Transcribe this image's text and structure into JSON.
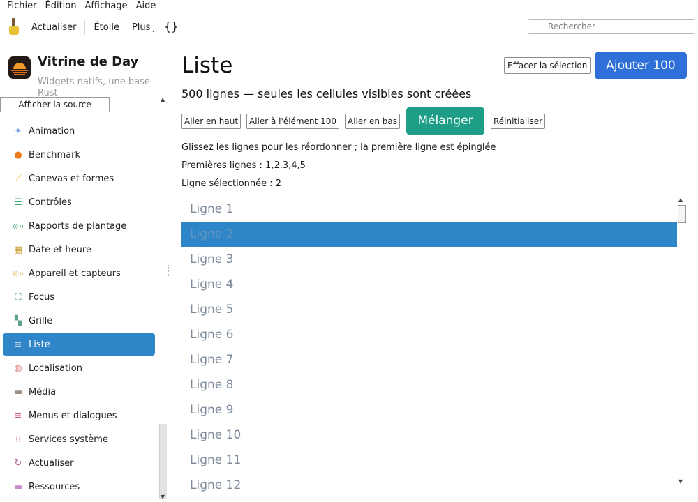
{
  "menubar": {
    "items": [
      "Fichier",
      "Édition",
      "Affichage",
      "Aide"
    ]
  },
  "toolbar": {
    "refresh_label": "Actualiser",
    "star_label": "Étoile",
    "more_label": "Plus",
    "more_chevron": "⌄",
    "braces": "{}",
    "search_placeholder": "Rechercher"
  },
  "app": {
    "title": "Vitrine de Day",
    "subtitle": "Widgets natifs, une base Rust"
  },
  "sidebar": {
    "show_source_label": "Afficher la source",
    "items": [
      {
        "label": "Animation",
        "icon": "sparkle-icon",
        "glyph": "✦",
        "color": "#7aa7e0"
      },
      {
        "label": "Benchmark",
        "icon": "gauge-icon",
        "glyph": "●",
        "color": "#f07a1a"
      },
      {
        "label": "Canevas et formes",
        "icon": "brush-icon",
        "glyph": "⟋",
        "color": "#f0a030"
      },
      {
        "label": "Contrôles",
        "icon": "sliders-icon",
        "glyph": "☰",
        "color": "#3aa66a"
      },
      {
        "label": "Rapports de plantage",
        "icon": "broadcast-icon",
        "glyph": "((·))",
        "color": "#3aa66a"
      },
      {
        "label": "Date et heure",
        "icon": "calendar-icon",
        "glyph": "▦",
        "color": "#c99a2e"
      },
      {
        "label": "Appareil et capteurs",
        "icon": "sensor-icon",
        "glyph": "((·))",
        "color": "#e0b040"
      },
      {
        "label": "Focus",
        "icon": "focus-icon",
        "glyph": "⛶",
        "color": "#2e9e86"
      },
      {
        "label": "Grille",
        "icon": "grid-icon",
        "glyph": "▚",
        "color": "#5aa38a"
      },
      {
        "label": "Liste",
        "icon": "list-icon",
        "glyph": "≡",
        "color": "#8fa6c8"
      },
      {
        "label": "Localisation",
        "icon": "globe-icon",
        "glyph": "◍",
        "color": "#e07a7a"
      },
      {
        "label": "Média",
        "icon": "film-icon",
        "glyph": "▬",
        "color": "#9a8f86"
      },
      {
        "label": "Menus et dialogues",
        "icon": "menu-icon",
        "glyph": "≡",
        "color": "#d05a7a"
      },
      {
        "label": "Services système",
        "icon": "dots-grid-icon",
        "glyph": "⁞⁞",
        "color": "#e0a0a0"
      },
      {
        "label": "Actualiser",
        "icon": "refresh-icon",
        "glyph": "↻",
        "color": "#b0609a"
      },
      {
        "label": "Ressources",
        "icon": "folder-icon",
        "glyph": "▬",
        "color": "#c78ac8"
      }
    ],
    "active_index": 9
  },
  "main": {
    "title": "Liste",
    "clear_label": "Effacer la sélection",
    "add_label": "Ajouter 100",
    "subtitle": "500 lignes — seules les cellules visibles sont créées",
    "actions": {
      "top": "Aller en haut",
      "item100": "Aller à l'élément 100",
      "bottom": "Aller en bas",
      "shuffle": "Mélanger",
      "reset": "Réinitialiser"
    },
    "hint": "Glissez les lignes pour les réordonner ; la première ligne est épinglée",
    "first_rows": "Premières lignes : 1,2,3,4,5",
    "selected_row": "Ligne sélectionnée : 2",
    "rows": [
      "Ligne 1",
      "Ligne 2",
      "Ligne 3",
      "Ligne 4",
      "Ligne 5",
      "Ligne 6",
      "Ligne 7",
      "Ligne 8",
      "Ligne 9",
      "Ligne 10",
      "Ligne 11",
      "Ligne 12"
    ],
    "selected_index": 1
  },
  "colors": {
    "accent": "#2e86c9",
    "add_button": "#2e6fd8",
    "shuffle_button": "#1e9e86"
  }
}
